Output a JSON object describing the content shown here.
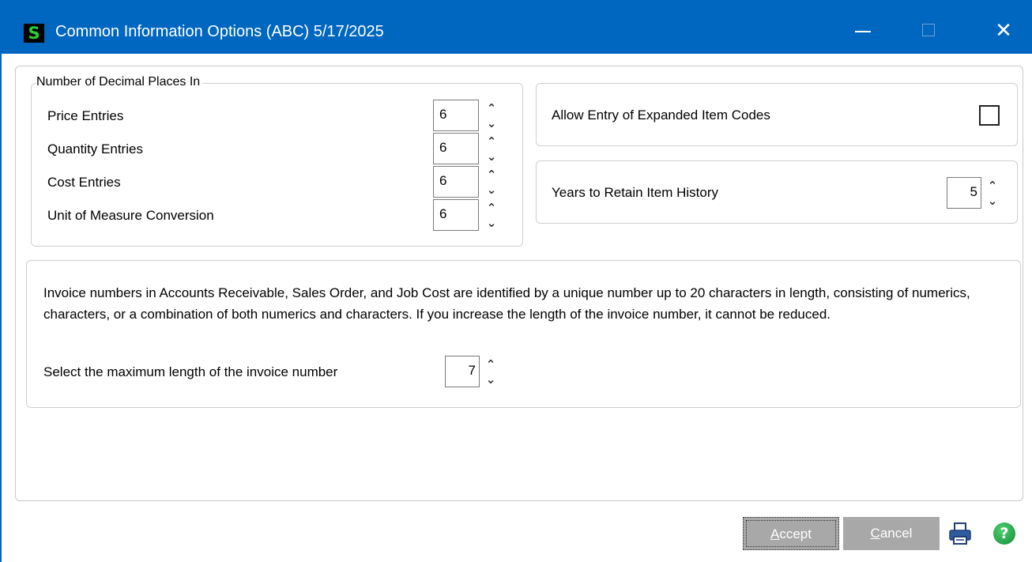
{
  "window": {
    "app_icon_letter": "S",
    "title": "Common Information Options (ABC) 5/17/2025",
    "controls": {
      "minimize": "—",
      "maximize": "☐",
      "close": "✕"
    }
  },
  "decimal_places": {
    "legend": "Number of Decimal Places In",
    "rows": [
      {
        "label": "Price Entries",
        "value": "6"
      },
      {
        "label": "Quantity Entries",
        "value": "6"
      },
      {
        "label": "Cost Entries",
        "value": "6"
      },
      {
        "label": "Unit of Measure Conversion",
        "value": "6"
      }
    ]
  },
  "expanded_item_codes": {
    "label": "Allow Entry of Expanded Item Codes",
    "checked": false
  },
  "item_history": {
    "label": "Years to Retain Item History",
    "value": "5"
  },
  "invoice": {
    "description": "Invoice numbers in Accounts Receivable, Sales Order, and Job Cost are identified by a unique number up to 20 characters in length, consisting of numerics, characters, or a combination of both numerics and characters. If you increase the length of the invoice number, it cannot be reduced.",
    "max_length_label": "Select the maximum length of the invoice number",
    "max_length_value": "7"
  },
  "spin": {
    "up": "⌃",
    "down": "⌄"
  },
  "buttons": {
    "accept_hotkey": "A",
    "accept_rest": "ccept",
    "cancel_hotkey": "C",
    "cancel_rest": "ancel"
  },
  "icons": {
    "printer": "printer-icon",
    "help": "help-icon",
    "help_glyph": "?"
  },
  "colors": {
    "titlebar": "#0067c0",
    "button_bg": "#a8a8a8",
    "help_green": "#1fa34a"
  }
}
